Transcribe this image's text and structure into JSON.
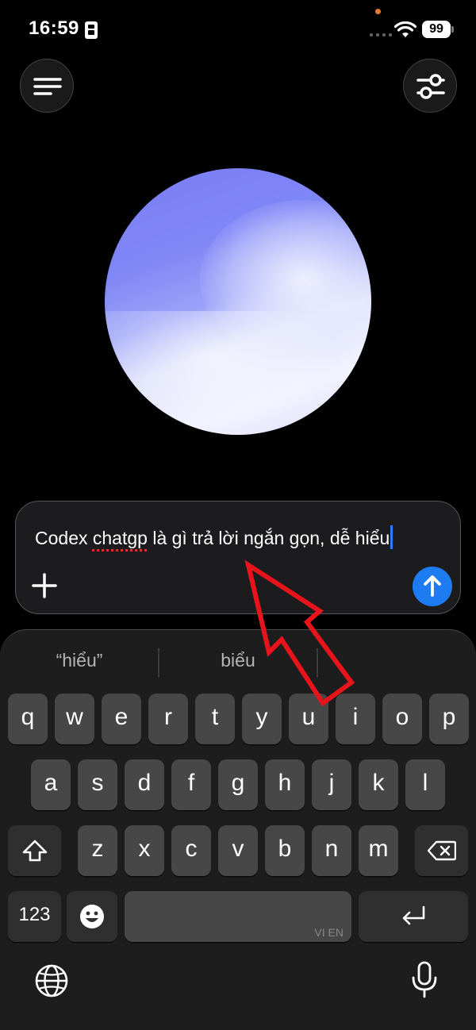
{
  "status_bar": {
    "time": "16:59",
    "battery": "99",
    "icons": [
      "sim-card-icon",
      "signal-dots-icon",
      "wifi-icon",
      "battery-icon"
    ]
  },
  "top_bar": {
    "left_button": "menu-icon",
    "right_button": "sliders-icon"
  },
  "composer": {
    "text_before": "Codex ",
    "misspelled_word": "chatgp",
    "text_after": " là gì trả lời ngắn gọn, dễ hiểu",
    "send_color": "#1e7cf2"
  },
  "keyboard": {
    "suggestions": [
      "“hiểu”",
      "biểu"
    ],
    "rows": [
      [
        "q",
        "w",
        "e",
        "r",
        "t",
        "y",
        "u",
        "i",
        "o",
        "p"
      ],
      [
        "a",
        "s",
        "d",
        "f",
        "g",
        "h",
        "j",
        "k",
        "l"
      ],
      [
        "z",
        "x",
        "c",
        "v",
        "b",
        "n",
        "m"
      ]
    ],
    "numbers_label": "123",
    "space_language": "VI EN"
  },
  "annotation": {
    "arrow_color": "#e8141b"
  }
}
